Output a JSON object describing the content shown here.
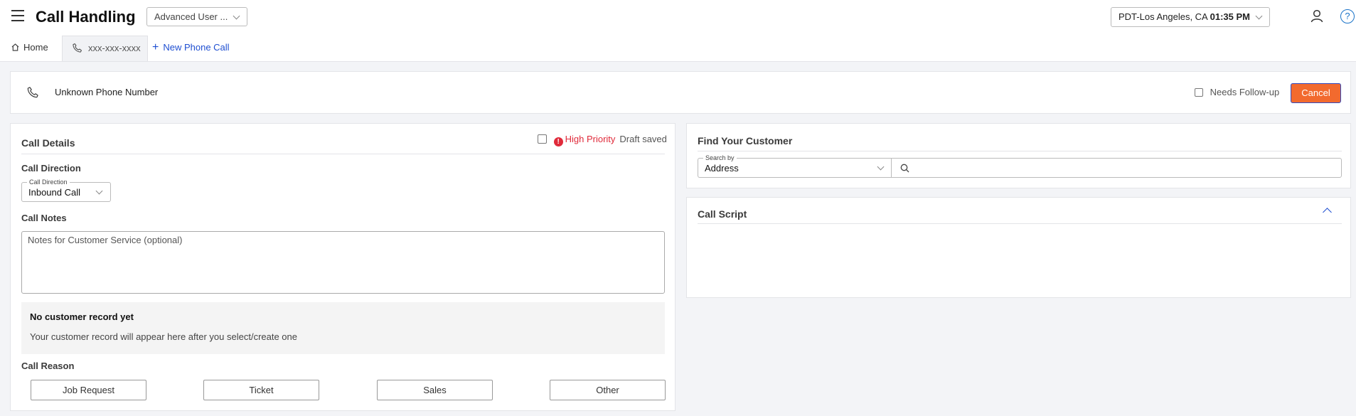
{
  "header": {
    "title": "Call Handling",
    "role_select": "Advanced User ...",
    "timezone": "PDT-Los Angeles, CA",
    "time": "01:35 PM",
    "help_glyph": "?"
  },
  "tabs": {
    "home": "Home",
    "phone": "xxx-xxx-xxxx",
    "new_call": "New Phone Call",
    "new_call_glyph": "+"
  },
  "call_bar": {
    "phone_label": "Unknown Phone Number",
    "followup": "Needs Follow-up",
    "cancel": "Cancel"
  },
  "details": {
    "title": "Call Details",
    "high_priority": "High Priority",
    "alert_glyph": "!",
    "draft_status": "Draft saved",
    "direction_heading": "Call Direction",
    "direction_label": "Call Direction",
    "direction_value": "Inbound Call",
    "notes_heading": "Call Notes",
    "notes_placeholder": "Notes for Customer Service (optional)",
    "no_record_title": "No customer record yet",
    "no_record_desc": "Your customer record will appear here after you select/create one",
    "reason_heading": "Call Reason",
    "reasons": [
      "Job Request",
      "Ticket",
      "Sales",
      "Other"
    ]
  },
  "find_customer": {
    "title": "Find Your Customer",
    "search_by_label": "Search by",
    "search_by_value": "Address"
  },
  "call_script": {
    "title": "Call Script"
  },
  "colors": {
    "accent": "#f26a2e",
    "link": "#1f4fd1",
    "alert": "#e02a3a"
  }
}
